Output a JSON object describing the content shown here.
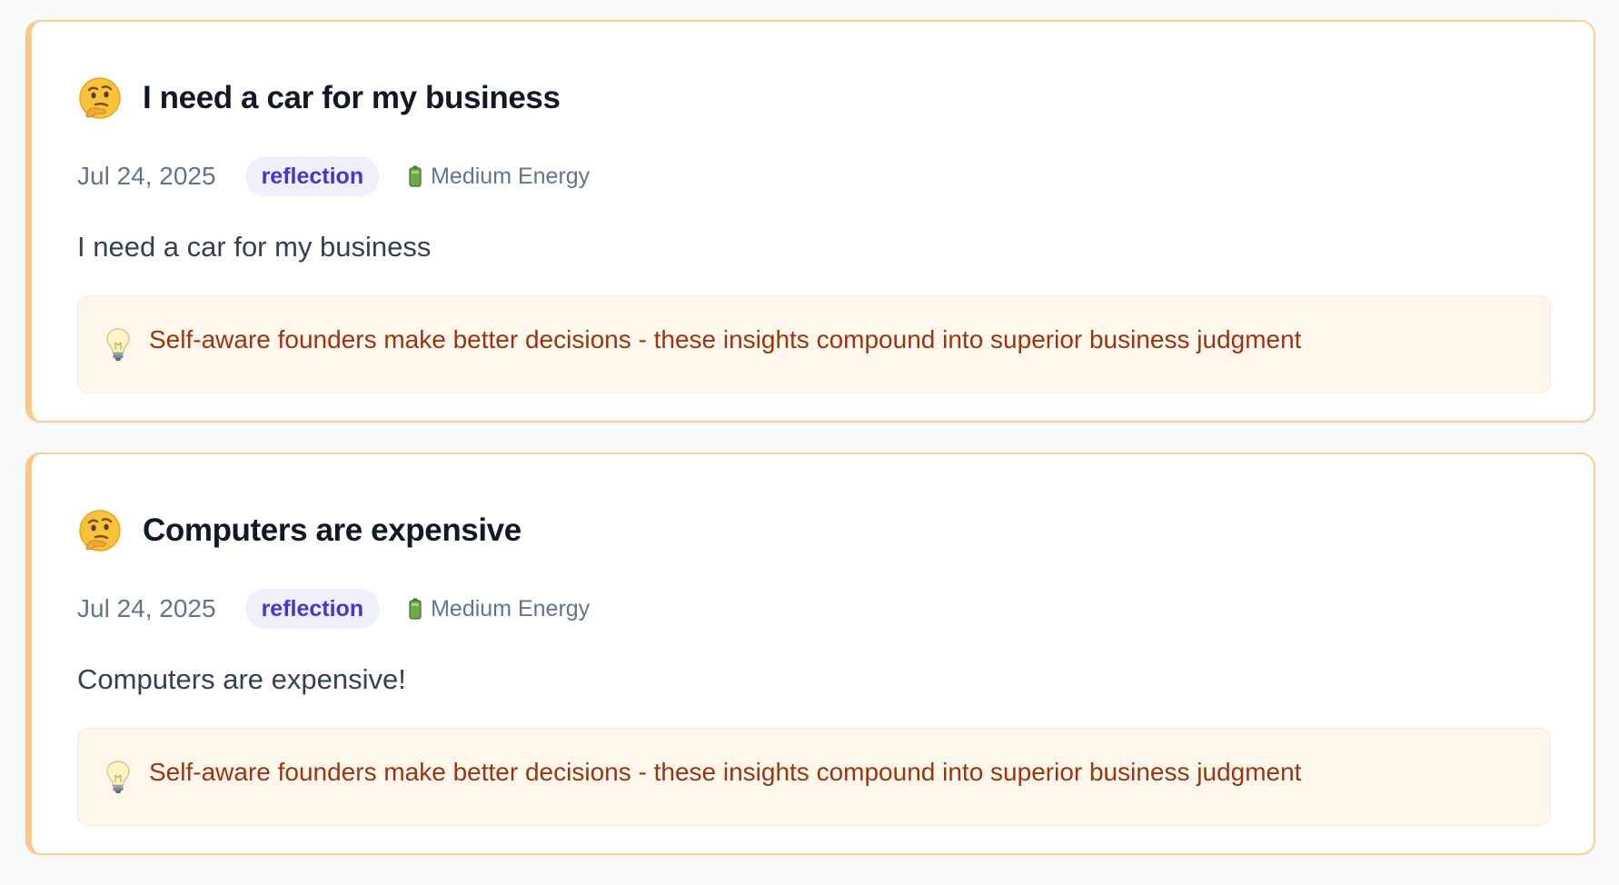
{
  "entries": [
    {
      "emoji": "thinking-face-icon",
      "title": "I need a car for my business",
      "date": "Jul 24, 2025",
      "tag": "reflection",
      "energy_icon": "battery-icon",
      "energy": "Medium Energy",
      "body": "I need a car for my business",
      "insight_icon": "lightbulb-icon",
      "insight": "Self-aware founders make better decisions - these insights compound into superior business judgment"
    },
    {
      "emoji": "thinking-face-icon",
      "title": "Computers are expensive",
      "date": "Jul 24, 2025",
      "tag": "reflection",
      "energy_icon": "battery-icon",
      "energy": "Medium Energy",
      "body": "Computers are expensive!",
      "insight_icon": "lightbulb-icon",
      "insight": "Self-aware founders make better decisions - these insights compound into superior business judgment"
    }
  ],
  "colors": {
    "card_border": "#f8cf95",
    "tag_bg": "#eef0fb",
    "tag_text": "#4338ca",
    "insight_bg": "#fff7ec",
    "insight_text": "#9a3412"
  }
}
